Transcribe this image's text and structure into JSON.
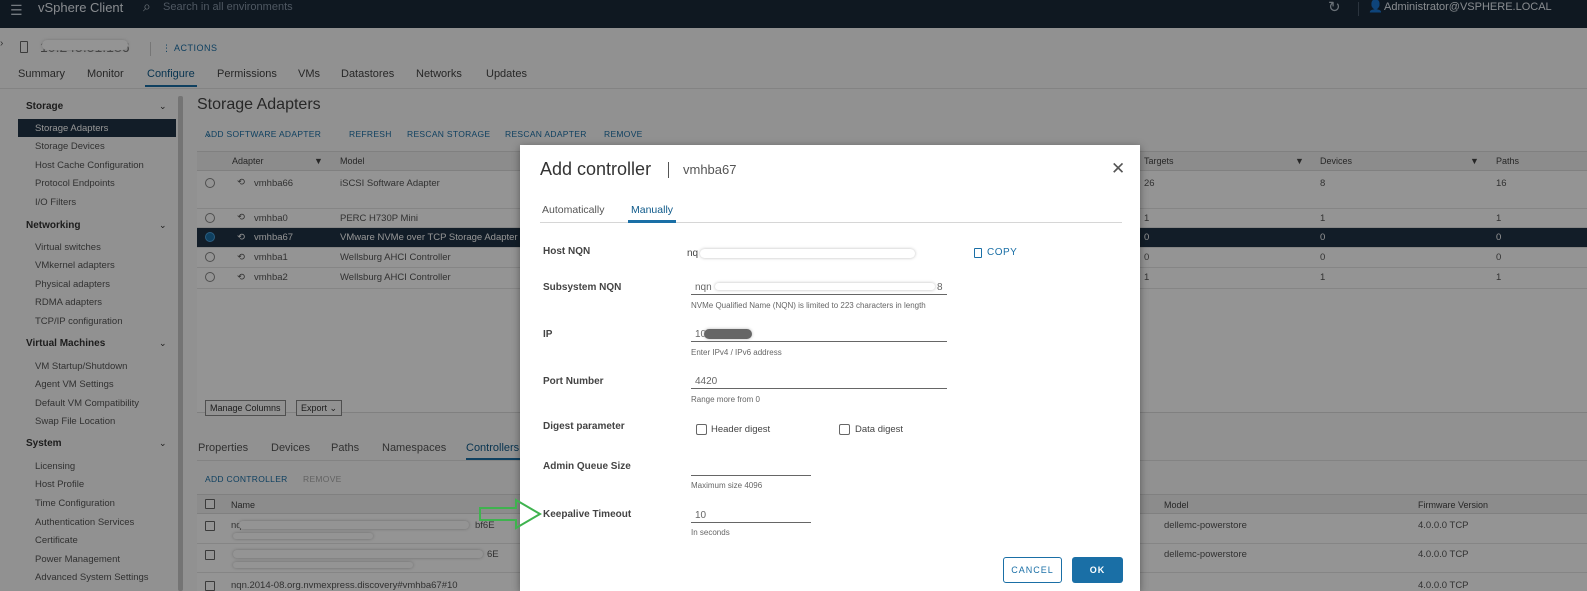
{
  "topbar": {
    "brand": "vSphere Client",
    "search_placeholder": "Search in all environments",
    "user": "Administrator@VSPHERE.LOCAL"
  },
  "host": {
    "name": "10.245.51.186",
    "actions_label": "ACTIONS"
  },
  "tabs": [
    "Summary",
    "Monitor",
    "Configure",
    "Permissions",
    "VMs",
    "Datastores",
    "Networks",
    "Updates"
  ],
  "active_tab": "Configure",
  "sidebar": {
    "groups": [
      {
        "label": "Storage",
        "items": [
          "Storage Adapters",
          "Storage Devices",
          "Host Cache Configuration",
          "Protocol Endpoints",
          "I/O Filters"
        ]
      },
      {
        "label": "Networking",
        "items": [
          "Virtual switches",
          "VMkernel adapters",
          "Physical adapters",
          "RDMA adapters",
          "TCP/IP configuration"
        ]
      },
      {
        "label": "Virtual Machines",
        "items": [
          "VM Startup/Shutdown",
          "Agent VM Settings",
          "Default VM Compatibility",
          "Swap File Location"
        ]
      },
      {
        "label": "System",
        "items": [
          "Licensing",
          "Host Profile",
          "Time Configuration",
          "Authentication Services",
          "Certificate",
          "Power Management",
          "Advanced System Settings"
        ]
      }
    ],
    "selected": "Storage Adapters"
  },
  "main": {
    "title": "Storage Adapters",
    "toolbar": [
      "ADD SOFTWARE ADAPTER",
      "REFRESH",
      "RESCAN STORAGE",
      "RESCAN ADAPTER",
      "REMOVE"
    ],
    "grid_headers": {
      "adapter": "Adapter",
      "model": "Model",
      "targets": "Targets",
      "devices": "Devices",
      "paths": "Paths"
    },
    "rows": [
      {
        "adapter": "vmhba66",
        "model": "iSCSI Software Adapter",
        "targets": "26",
        "devices": "8",
        "paths": "16"
      },
      {
        "adapter": "vmhba0",
        "model": "PERC H730P Mini",
        "targets": "1",
        "devices": "1",
        "paths": "1"
      },
      {
        "adapter": "vmhba67",
        "model": "VMware NVMe over TCP Storage Adapter",
        "targets": "0",
        "devices": "0",
        "paths": "0",
        "selected": true
      },
      {
        "adapter": "vmhba1",
        "model": "Wellsburg AHCI Controller",
        "targets": "0",
        "devices": "0",
        "paths": "0"
      },
      {
        "adapter": "vmhba2",
        "model": "Wellsburg AHCI Controller",
        "targets": "1",
        "devices": "1",
        "paths": "1"
      }
    ],
    "manage_columns": "Manage Columns",
    "export": "Export",
    "subtabs": [
      "Properties",
      "Devices",
      "Paths",
      "Namespaces",
      "Controllers"
    ],
    "active_subtab": "Controllers",
    "ctrl_toolbar": {
      "add": "ADD CONTROLLER",
      "remove": "REMOVE"
    },
    "ctrl_headers": {
      "name": "Name",
      "model": "Model",
      "firmware": "Firmware Version"
    },
    "ctrl_rows": [
      {
        "name_prefix": "nq",
        "name_suffix": "bf6E",
        "model": "dellemc-powerstore",
        "firmware": "4.0.0.0 TCP"
      },
      {
        "name_prefix": "",
        "name_suffix": "6E",
        "model": "dellemc-powerstore",
        "firmware": "4.0.0.0 TCP"
      },
      {
        "name_prefix": "nqn.2014-08.org.nvmexpress.discovery#vmhba67#10",
        "name_suffix": "",
        "model": "",
        "firmware": "4.0.0.0 TCP"
      }
    ]
  },
  "modal": {
    "title": "Add controller",
    "subtitle": "vmhba67",
    "tabs": [
      "Automatically",
      "Manually"
    ],
    "active_tab": "Manually",
    "host_nqn_label": "Host NQN",
    "host_nqn_value": "nq",
    "copy_label": "COPY",
    "subsystem_nqn_label": "Subsystem NQN",
    "subsystem_nqn_value": "nqn",
    "subsystem_nqn_suffix": "8",
    "subsystem_nqn_help": "NVMe Qualified Name (NQN) is limited to 223 characters in length",
    "ip_label": "IP",
    "ip_value": "10",
    "ip_help": "Enter IPv4 / IPv6 address",
    "port_label": "Port Number",
    "port_value": "4420",
    "port_help": "Range more from 0",
    "digest_label": "Digest parameter",
    "header_digest": "Header digest",
    "data_digest": "Data digest",
    "admin_queue_label": "Admin Queue Size",
    "admin_queue_value": "",
    "admin_queue_help": "Maximum size 4096",
    "keepalive_label": "Keepalive Timeout",
    "keepalive_value": "10",
    "keepalive_help": "In seconds",
    "cancel": "CANCEL",
    "ok": "OK"
  },
  "colors": {
    "accent": "#1a6fa6",
    "topbar": "#1b2a3a",
    "selection": "#1f3245",
    "annotation_arrow": "#3fb34f"
  }
}
